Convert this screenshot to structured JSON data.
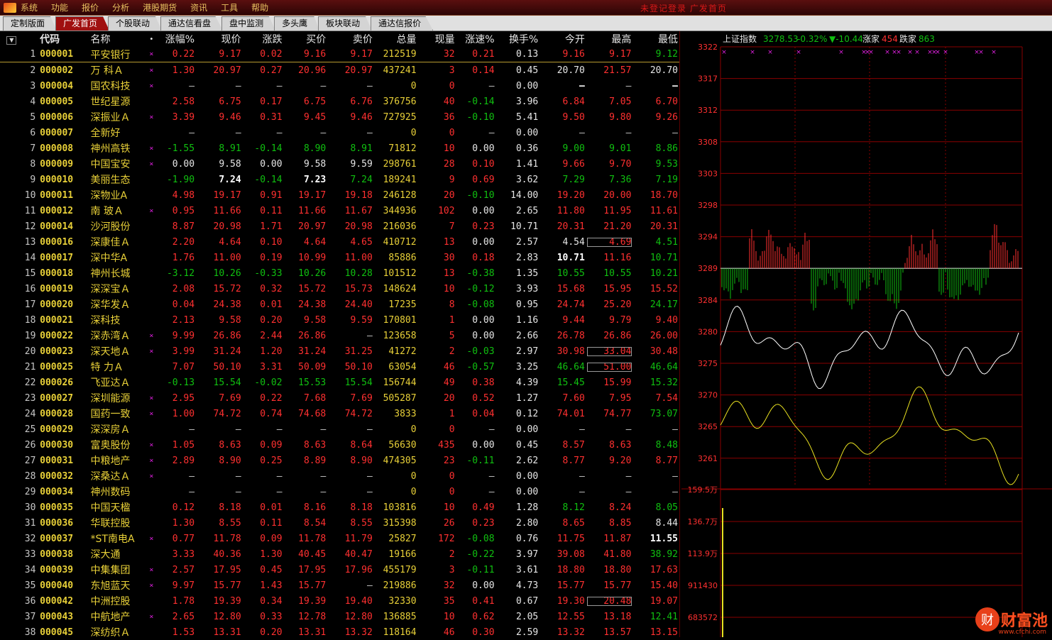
{
  "menu": [
    "系统",
    "功能",
    "报价",
    "分析",
    "港股期货",
    "资讯",
    "工具",
    "帮助"
  ],
  "window_title": "未登记登录   广发首页",
  "tabs": [
    {
      "label": "定制版面",
      "active": false
    },
    {
      "label": "广发首页",
      "active": true
    },
    {
      "label": "个股联动",
      "active": false
    },
    {
      "label": "通达信看盘",
      "active": false
    },
    {
      "label": "盘中监测",
      "active": false
    },
    {
      "label": "多头鹰",
      "active": false
    },
    {
      "label": "板块联动",
      "active": false
    },
    {
      "label": "通达信报价",
      "active": false
    }
  ],
  "table": {
    "sort_icon": "▼",
    "headers": {
      "code": "代码",
      "name": "名称",
      "dot": "•",
      "pct": "涨幅%",
      "price": "现价",
      "chg": "涨跌",
      "bid": "买价",
      "ask": "卖价",
      "vol": "总量",
      "cur": "现量",
      "spd": "涨速%",
      "turn": "换手%",
      "open": "今开",
      "high": "最高",
      "low": "最低"
    },
    "rows": [
      [
        "1",
        "000001",
        "平安银行",
        "×",
        "0.22",
        "9.17",
        "0.02",
        "9.16",
        "9.17",
        "212519",
        "32",
        "0.21",
        "0.13",
        "9.16",
        "9.17",
        "9.12"
      ],
      [
        "2",
        "000002",
        "万 科Ａ",
        "×",
        "1.30",
        "20.97",
        "0.27",
        "20.96",
        "20.97",
        "437241",
        "3",
        "0.14",
        "0.45",
        "20.70",
        "21.57",
        "20.70"
      ],
      [
        "3",
        "000004",
        "国农科技",
        "×",
        "–",
        "–",
        "–",
        "–",
        "–",
        "0",
        "0",
        "–",
        "0.00",
        "–",
        "–",
        "–"
      ],
      [
        "4",
        "000005",
        "世纪星源",
        "",
        "2.58",
        "6.75",
        "0.17",
        "6.75",
        "6.76",
        "376756",
        "40",
        "-0.14",
        "3.96",
        "6.84",
        "7.05",
        "6.70"
      ],
      [
        "5",
        "000006",
        "深振业Ａ",
        "×",
        "3.39",
        "9.46",
        "0.31",
        "9.45",
        "9.46",
        "727925",
        "36",
        "-0.10",
        "5.41",
        "9.50",
        "9.80",
        "9.26"
      ],
      [
        "6",
        "000007",
        "全新好",
        "",
        "–",
        "–",
        "–",
        "–",
        "–",
        "0",
        "0",
        "–",
        "0.00",
        "–",
        "–",
        "–"
      ],
      [
        "7",
        "000008",
        "神州高铁",
        "×",
        "-1.55",
        "8.91",
        "-0.14",
        "8.90",
        "8.91",
        "71812",
        "10",
        "0.00",
        "0.36",
        "9.00",
        "9.01",
        "8.86"
      ],
      [
        "8",
        "000009",
        "中国宝安",
        "×",
        "0.00",
        "9.58",
        "0.00",
        "9.58",
        "9.59",
        "298761",
        "28",
        "0.10",
        "1.41",
        "9.66",
        "9.70",
        "9.53"
      ],
      [
        "9",
        "000010",
        "美丽生态",
        "",
        "-1.90",
        "7.24",
        "-0.14",
        "7.23",
        "7.24",
        "189241",
        "9",
        "0.69",
        "3.62",
        "7.29",
        "7.36",
        "7.19"
      ],
      [
        "10",
        "000011",
        "深物业A",
        "",
        "4.98",
        "19.17",
        "0.91",
        "19.17",
        "19.18",
        "246128",
        "20",
        "-0.10",
        "14.00",
        "19.20",
        "20.00",
        "18.70"
      ],
      [
        "11",
        "000012",
        "南 玻Ａ",
        "×",
        "0.95",
        "11.66",
        "0.11",
        "11.66",
        "11.67",
        "344936",
        "102",
        "0.00",
        "2.65",
        "11.80",
        "11.95",
        "11.61"
      ],
      [
        "12",
        "000014",
        "沙河股份",
        "",
        "8.87",
        "20.98",
        "1.71",
        "20.97",
        "20.98",
        "216036",
        "7",
        "0.23",
        "10.71",
        "20.31",
        "21.20",
        "20.31"
      ],
      [
        "13",
        "000016",
        "深康佳Ａ",
        "",
        "2.20",
        "4.64",
        "0.10",
        "4.64",
        "4.65",
        "410712",
        "13",
        "0.00",
        "2.57",
        "4.54",
        "4.69",
        "4.51"
      ],
      [
        "14",
        "000017",
        "深中华A",
        "",
        "1.76",
        "11.00",
        "0.19",
        "10.99",
        "11.00",
        "85886",
        "30",
        "0.18",
        "2.83",
        "10.71",
        "11.16",
        "10.71"
      ],
      [
        "15",
        "000018",
        "神州长城",
        "",
        "-3.12",
        "10.26",
        "-0.33",
        "10.26",
        "10.28",
        "101512",
        "13",
        "-0.38",
        "1.35",
        "10.55",
        "10.55",
        "10.21"
      ],
      [
        "16",
        "000019",
        "深深宝Ａ",
        "",
        "2.08",
        "15.72",
        "0.32",
        "15.72",
        "15.73",
        "148624",
        "10",
        "-0.12",
        "3.93",
        "15.68",
        "15.95",
        "15.52"
      ],
      [
        "17",
        "000020",
        "深华发Ａ",
        "",
        "0.04",
        "24.38",
        "0.01",
        "24.38",
        "24.40",
        "17235",
        "8",
        "-0.08",
        "0.95",
        "24.74",
        "25.20",
        "24.17"
      ],
      [
        "18",
        "000021",
        "深科技",
        "",
        "2.13",
        "9.58",
        "0.20",
        "9.58",
        "9.59",
        "170801",
        "1",
        "0.00",
        "1.16",
        "9.44",
        "9.79",
        "9.40"
      ],
      [
        "19",
        "000022",
        "深赤湾Ａ",
        "×",
        "9.99",
        "26.86",
        "2.44",
        "26.86",
        "–",
        "123658",
        "5",
        "0.00",
        "2.66",
        "26.78",
        "26.86",
        "26.00"
      ],
      [
        "20",
        "000023",
        "深天地Ａ",
        "×",
        "3.99",
        "31.24",
        "1.20",
        "31.24",
        "31.25",
        "41272",
        "2",
        "-0.03",
        "2.97",
        "30.98",
        "33.04",
        "30.48"
      ],
      [
        "21",
        "000025",
        "特 力Ａ",
        "",
        "7.07",
        "50.10",
        "3.31",
        "50.09",
        "50.10",
        "63054",
        "46",
        "-0.57",
        "3.25",
        "46.64",
        "51.00",
        "46.64"
      ],
      [
        "22",
        "000026",
        "飞亚达Ａ",
        "",
        "-0.13",
        "15.54",
        "-0.02",
        "15.53",
        "15.54",
        "156744",
        "49",
        "0.38",
        "4.39",
        "15.45",
        "15.99",
        "15.32"
      ],
      [
        "23",
        "000027",
        "深圳能源",
        "×",
        "2.95",
        "7.69",
        "0.22",
        "7.68",
        "7.69",
        "505287",
        "20",
        "0.52",
        "1.27",
        "7.60",
        "7.95",
        "7.54"
      ],
      [
        "24",
        "000028",
        "国药一致",
        "×",
        "1.00",
        "74.72",
        "0.74",
        "74.68",
        "74.72",
        "3833",
        "1",
        "0.04",
        "0.12",
        "74.01",
        "74.77",
        "73.07"
      ],
      [
        "25",
        "000029",
        "深深房Ａ",
        "",
        "–",
        "–",
        "–",
        "–",
        "–",
        "0",
        "0",
        "–",
        "0.00",
        "–",
        "–",
        "–"
      ],
      [
        "26",
        "000030",
        "富奥股份",
        "×",
        "1.05",
        "8.63",
        "0.09",
        "8.63",
        "8.64",
        "56630",
        "435",
        "0.00",
        "0.45",
        "8.57",
        "8.63",
        "8.48"
      ],
      [
        "27",
        "000031",
        "中粮地产",
        "×",
        "2.89",
        "8.90",
        "0.25",
        "8.89",
        "8.90",
        "474305",
        "23",
        "-0.11",
        "2.62",
        "8.77",
        "9.20",
        "8.77"
      ],
      [
        "28",
        "000032",
        "深桑达Ａ",
        "×",
        "–",
        "–",
        "–",
        "–",
        "–",
        "0",
        "0",
        "–",
        "0.00",
        "–",
        "–",
        "–"
      ],
      [
        "29",
        "000034",
        "神州数码",
        "",
        "–",
        "–",
        "–",
        "–",
        "–",
        "0",
        "0",
        "–",
        "0.00",
        "–",
        "–",
        "–"
      ],
      [
        "30",
        "000035",
        "中国天楹",
        "",
        "0.12",
        "8.18",
        "0.01",
        "8.16",
        "8.18",
        "103816",
        "10",
        "0.49",
        "1.28",
        "8.12",
        "8.24",
        "8.05"
      ],
      [
        "31",
        "000036",
        "华联控股",
        "",
        "1.30",
        "8.55",
        "0.11",
        "8.54",
        "8.55",
        "315398",
        "26",
        "0.23",
        "2.80",
        "8.65",
        "8.85",
        "8.44"
      ],
      [
        "32",
        "000037",
        "*ST南电A",
        "×",
        "0.77",
        "11.78",
        "0.09",
        "11.78",
        "11.79",
        "25827",
        "172",
        "-0.08",
        "0.76",
        "11.75",
        "11.87",
        "11.55"
      ],
      [
        "33",
        "000038",
        "深大通",
        "",
        "3.33",
        "40.36",
        "1.30",
        "40.45",
        "40.47",
        "19166",
        "2",
        "-0.22",
        "3.97",
        "39.08",
        "41.80",
        "38.92"
      ],
      [
        "34",
        "000039",
        "中集集团",
        "×",
        "2.57",
        "17.95",
        "0.45",
        "17.95",
        "17.96",
        "455179",
        "3",
        "-0.11",
        "3.61",
        "18.80",
        "18.80",
        "17.63"
      ],
      [
        "35",
        "000040",
        "东旭蓝天",
        "×",
        "9.97",
        "15.77",
        "1.43",
        "15.77",
        "–",
        "219886",
        "32",
        "0.00",
        "4.73",
        "15.77",
        "15.77",
        "15.40"
      ],
      [
        "36",
        "000042",
        "中洲控股",
        "",
        "1.78",
        "19.39",
        "0.34",
        "19.39",
        "19.40",
        "32330",
        "35",
        "0.41",
        "0.67",
        "19.30",
        "20.48",
        "19.07"
      ],
      [
        "37",
        "000043",
        "中航地产",
        "×",
        "2.65",
        "12.80",
        "0.33",
        "12.78",
        "12.80",
        "136885",
        "10",
        "0.62",
        "2.05",
        "12.55",
        "13.18",
        "12.41"
      ],
      [
        "38",
        "000045",
        "深纺织Ａ",
        "",
        "1.53",
        "13.31",
        "0.20",
        "13.31",
        "13.32",
        "118164",
        "46",
        "0.30",
        "2.59",
        "13.32",
        "13.57",
        "13.15"
      ]
    ],
    "bold_cells": [
      [
        2,
        13
      ],
      [
        2,
        15
      ],
      [
        8,
        5
      ],
      [
        8,
        7
      ],
      [
        13,
        13
      ],
      [
        31,
        15
      ]
    ],
    "boxed_cells": [
      [
        12,
        14
      ],
      [
        19,
        14
      ],
      [
        20,
        14
      ],
      [
        35,
        14
      ]
    ]
  },
  "index_chart": {
    "name": "上证指数",
    "value": "3278.53",
    "pct": "-0.32%",
    "change": "▼-10.44",
    "up_label": "涨家",
    "up_count": "454",
    "down_label": "跌家",
    "down_count": "863",
    "y_ticks": [
      "3322",
      "3317",
      "3312",
      "3308",
      "3303",
      "3298",
      "3294",
      "3289",
      "3284",
      "3280",
      "3275",
      "3270",
      "3265",
      "3261"
    ],
    "vol_ticks": [
      "159.5万",
      "136.7万",
      "113.9万",
      "911430",
      "683572"
    ],
    "colors": {
      "white_line": "#ffffff",
      "yellow_line": "#e8e020",
      "up_bar": "#ff3030",
      "down_bar": "#10c010",
      "grid": "#8a0000"
    }
  },
  "watermark": {
    "icon": "财",
    "text": "财富池",
    "url": "www.cfchi.com"
  }
}
